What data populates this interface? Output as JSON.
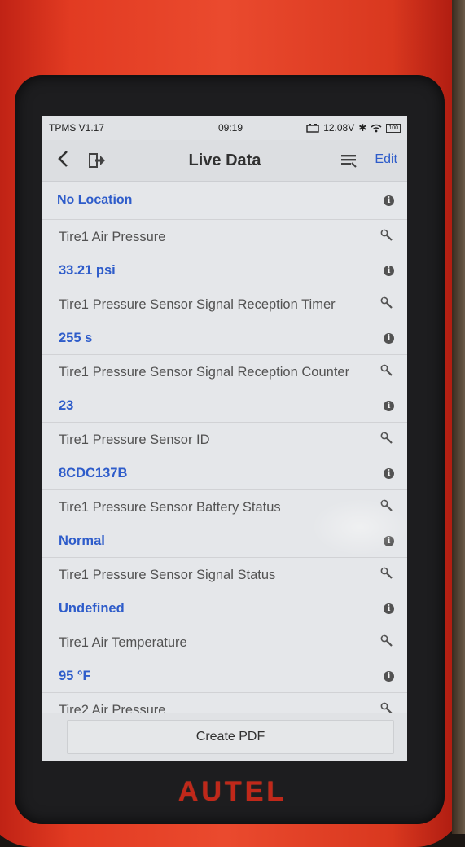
{
  "status_bar": {
    "app_version": "TPMS V1.17",
    "time": "09:19",
    "voltage": "12.08V",
    "battery": "100"
  },
  "nav": {
    "title": "Live Data",
    "edit_label": "Edit"
  },
  "location": "No Location",
  "items": [
    {
      "name": "Tire1 Air Pressure",
      "value": "33.21 psi"
    },
    {
      "name": "Tire1 Pressure Sensor Signal Reception Timer",
      "value": "255 s"
    },
    {
      "name": "Tire1 Pressure Sensor Signal Reception Counter",
      "value": "23"
    },
    {
      "name": "Tire1 Pressure Sensor ID",
      "value": "8CDC137B"
    },
    {
      "name": "Tire1 Pressure Sensor Battery Status",
      "value": "Normal"
    },
    {
      "name": "Tire1 Pressure Sensor Signal Status",
      "value": "Undefined"
    },
    {
      "name": "Tire1 Air Temperature",
      "value": "95 °F"
    },
    {
      "name": "Tire2 Air Pressure",
      "value": ""
    }
  ],
  "create_pdf_label": "Create PDF",
  "device_brand": "AUTEL",
  "colors": {
    "accent_blue": "#2f5fd0",
    "device_red": "#e23b22"
  }
}
